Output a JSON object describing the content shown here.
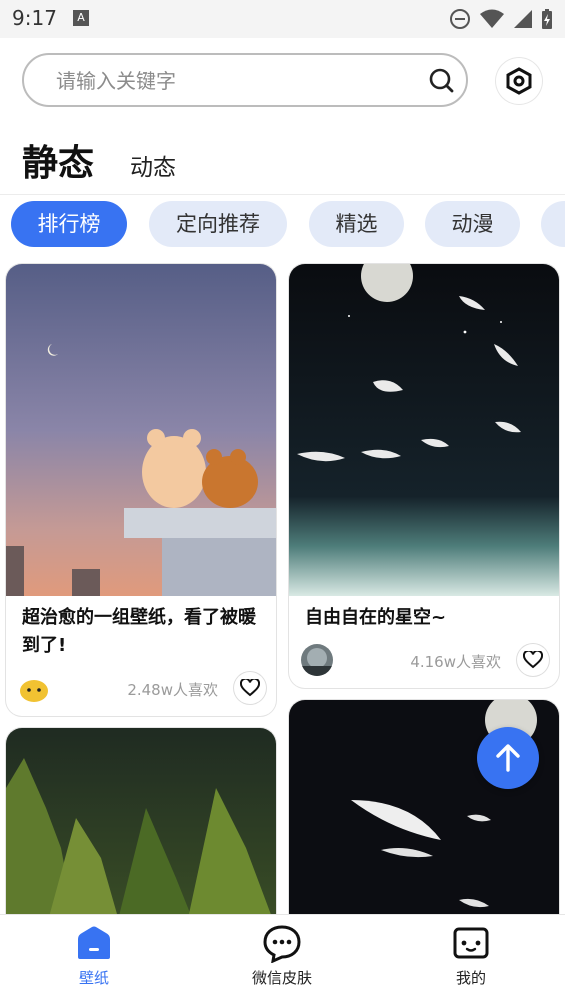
{
  "status_bar": {
    "time": "9:17",
    "a_badge": "A"
  },
  "search": {
    "placeholder": "请输入关键字",
    "value": ""
  },
  "main_tabs": [
    {
      "label": "静态",
      "active": true
    },
    {
      "label": "动态",
      "active": false
    }
  ],
  "categories": [
    {
      "label": "排行榜",
      "active": true
    },
    {
      "label": "定向推荐",
      "active": false
    },
    {
      "label": "精选",
      "active": false
    },
    {
      "label": "动漫",
      "active": false
    }
  ],
  "cards": [
    {
      "title": "超治愈的一组壁纸，看了被暖到了!",
      "likes": "2.48w人喜欢"
    },
    {
      "title": "自由自在的星空~",
      "likes": "4.16w人喜欢"
    }
  ],
  "bottom_nav": [
    {
      "label": "壁纸",
      "icon": "home-icon",
      "active": true
    },
    {
      "label": "微信皮肤",
      "icon": "chat-bubble-icon",
      "active": false
    },
    {
      "label": "我的",
      "icon": "profile-box-icon",
      "active": false
    }
  ],
  "colors": {
    "accent": "#3873f2",
    "chip_bg": "#e3eaf8",
    "muted_text": "#9b9b9b"
  }
}
